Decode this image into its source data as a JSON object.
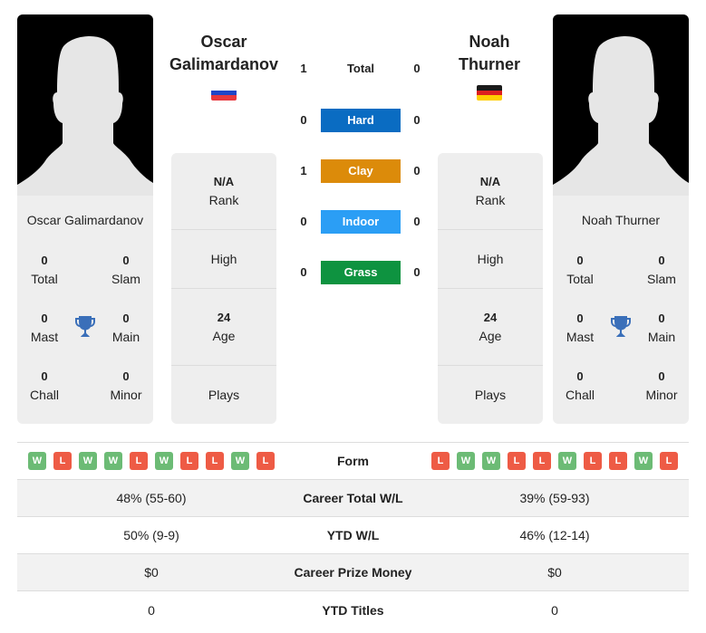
{
  "colors": {
    "hard": "#0a6cc2",
    "clay": "#dc8b0a",
    "indoor": "#2b9ef5",
    "grass": "#0e9340",
    "win": "#6cbb75",
    "loss": "#ee5b45",
    "trophy": "#3a6fb9"
  },
  "left_player": {
    "name": "Oscar Galimardanov",
    "name_line1": "Oscar",
    "name_line2": "Galimardanov",
    "flag": "russia-flag",
    "flag_colors": [
      "#ffffff",
      "#1f46c8",
      "#e8383d"
    ],
    "titles": {
      "total": {
        "value": "0",
        "label": "Total"
      },
      "slam": {
        "value": "0",
        "label": "Slam"
      },
      "mast": {
        "value": "0",
        "label": "Mast"
      },
      "main": {
        "value": "0",
        "label": "Main"
      },
      "chall": {
        "value": "0",
        "label": "Chall"
      },
      "minor": {
        "value": "0",
        "label": "Minor"
      }
    },
    "info": {
      "rank_value": "N/A",
      "rank_label": "Rank",
      "high_label": "High",
      "age_value": "24",
      "age_label": "Age",
      "plays_label": "Plays"
    },
    "form": [
      "W",
      "L",
      "W",
      "W",
      "L",
      "W",
      "L",
      "L",
      "W",
      "L"
    ],
    "career_wl": "48% (55-60)",
    "ytd_wl": "50% (9-9)",
    "prize_money": "$0",
    "ytd_titles": "0"
  },
  "right_player": {
    "name": "Noah Thurner",
    "name_line1": "Noah",
    "name_line2": "Thurner",
    "flag": "germany-flag",
    "flag_colors": [
      "#1a1a1a",
      "#dd1f1f",
      "#ffce00"
    ],
    "titles": {
      "total": {
        "value": "0",
        "label": "Total"
      },
      "slam": {
        "value": "0",
        "label": "Slam"
      },
      "mast": {
        "value": "0",
        "label": "Mast"
      },
      "main": {
        "value": "0",
        "label": "Main"
      },
      "chall": {
        "value": "0",
        "label": "Chall"
      },
      "minor": {
        "value": "0",
        "label": "Minor"
      }
    },
    "info": {
      "rank_value": "N/A",
      "rank_label": "Rank",
      "high_label": "High",
      "age_value": "24",
      "age_label": "Age",
      "plays_label": "Plays"
    },
    "form": [
      "L",
      "W",
      "W",
      "L",
      "L",
      "W",
      "L",
      "L",
      "W",
      "L"
    ],
    "career_wl": "39% (59-93)",
    "ytd_wl": "46% (12-14)",
    "prize_money": "$0",
    "ytd_titles": "0"
  },
  "h2h": [
    {
      "label": "Total",
      "left": "1",
      "right": "0",
      "surface": "total"
    },
    {
      "label": "Hard",
      "left": "0",
      "right": "0",
      "surface": "hard"
    },
    {
      "label": "Clay",
      "left": "1",
      "right": "0",
      "surface": "clay"
    },
    {
      "label": "Indoor",
      "left": "0",
      "right": "0",
      "surface": "indoor"
    },
    {
      "label": "Grass",
      "left": "0",
      "right": "0",
      "surface": "grass"
    }
  ],
  "stat_labels": {
    "form": "Form",
    "career_wl": "Career Total W/L",
    "ytd_wl": "YTD W/L",
    "prize_money": "Career Prize Money",
    "ytd_titles": "YTD Titles"
  }
}
